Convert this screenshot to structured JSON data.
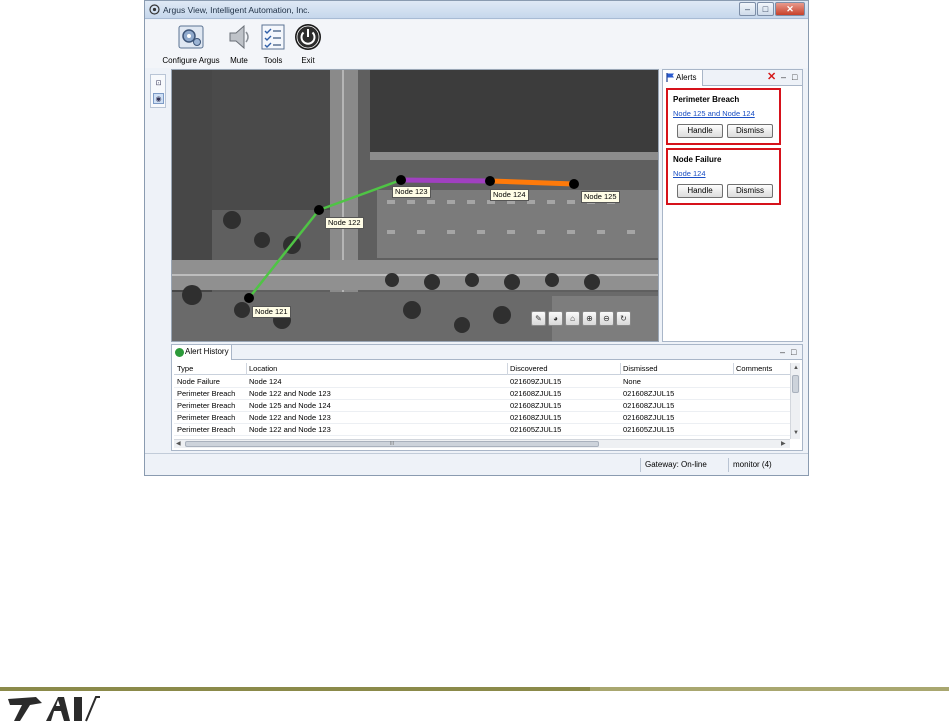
{
  "window": {
    "title": "Argus View, Intelligent Automation, Inc.",
    "controls": {
      "minimize": "–",
      "maximize": "□",
      "close": "✕"
    }
  },
  "toolbar": {
    "items": [
      {
        "label": "Configure Argus",
        "icon": "configure-icon"
      },
      {
        "label": "Mute",
        "icon": "speaker-icon"
      },
      {
        "label": "Tools",
        "icon": "checklist-icon"
      },
      {
        "label": "Exit",
        "icon": "power-icon"
      }
    ]
  },
  "map": {
    "nodes": [
      {
        "label": "Node 121"
      },
      {
        "label": "Node 122"
      },
      {
        "label": "Node 123"
      },
      {
        "label": "Node 124"
      },
      {
        "label": "Node 125"
      }
    ],
    "link_colors": {
      "green": "#4fc445",
      "purple": "#a040c0",
      "orange": "#ff7a0a"
    },
    "tools": [
      "pencil-icon",
      "color-wheel-icon",
      "home-icon",
      "zoom-in-icon",
      "zoom-out-icon",
      "refresh-icon"
    ]
  },
  "alerts": {
    "tab_label": "Alerts",
    "items": [
      {
        "title": "Perimeter Breach",
        "location": "Node 125 and Node 124",
        "handle_label": "Handle",
        "dismiss_label": "Dismiss"
      },
      {
        "title": "Node Failure",
        "location": "Node 124",
        "handle_label": "Handle",
        "dismiss_label": "Dismiss"
      }
    ]
  },
  "history": {
    "tab_label": "Alert History",
    "columns": [
      "Type",
      "Location",
      "Discovered",
      "Dismissed",
      "Comments"
    ],
    "rows": [
      [
        "Node Failure",
        "Node 124",
        "021609ZJUL15",
        "None",
        ""
      ],
      [
        "Perimeter Breach",
        "Node 122 and Node 123",
        "021608ZJUL15",
        "021608ZJUL15",
        ""
      ],
      [
        "Perimeter Breach",
        "Node 125 and Node 124",
        "021608ZJUL15",
        "021608ZJUL15",
        ""
      ],
      [
        "Perimeter Breach",
        "Node 122 and Node 123",
        "021608ZJUL15",
        "021608ZJUL15",
        ""
      ],
      [
        "Perimeter Breach",
        "Node 122 and Node 123",
        "021605ZJUL15",
        "021605ZJUL15",
        ""
      ]
    ],
    "scroll_grip": "III"
  },
  "status": {
    "gateway": "Gateway: On-line",
    "user": "monitor (4)"
  },
  "footer": {
    "logo_text": "IAI"
  }
}
